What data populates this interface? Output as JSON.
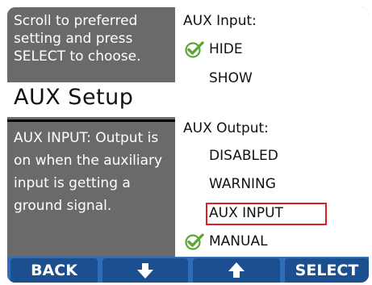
{
  "left_panel": {
    "instruction": "Scroll to preferred setting and press SELECT to choose.",
    "title": "AUX Setup",
    "description": "AUX INPUT: Output is on when the auxiliary input is getting a ground signal."
  },
  "right_panel": {
    "aux_input_header": "AUX Input:",
    "aux_input_options": [
      "HIDE",
      "SHOW"
    ],
    "aux_input_selected": "HIDE",
    "aux_output_header": "AUX Output:",
    "aux_output_options": [
      "DISABLED",
      "WARNING",
      "AUX INPUT",
      "MANUAL"
    ],
    "aux_output_selected": "MANUAL",
    "aux_output_highlighted": "AUX INPUT"
  },
  "softkeys": {
    "back": "BACK",
    "down_icon": "arrow-down-icon",
    "up_icon": "arrow-up-icon",
    "select": "SELECT"
  },
  "colors": {
    "panel_gray": "#6a6a6a",
    "softkey_blue": "#1c4f8f",
    "check_green": "#5aa832",
    "highlight_red": "#e02020"
  }
}
